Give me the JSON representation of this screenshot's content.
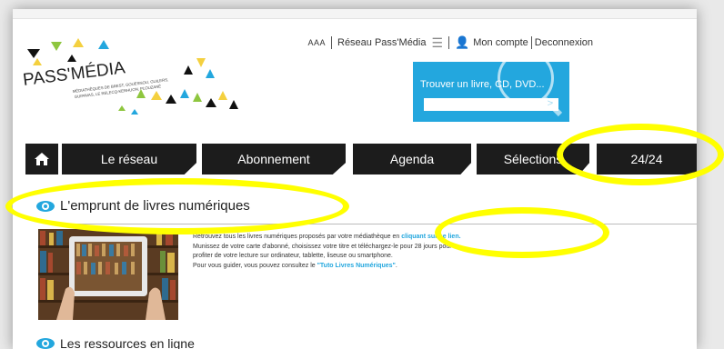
{
  "utility": {
    "font_size": "AAA",
    "network_link": "Réseau Pass'Média",
    "menu_icon": "hamburger-icon",
    "account": "Mon compte",
    "logout": "Deconnexion"
  },
  "logo": {
    "title": "PASS'MÉDIA",
    "subtitle_line1": "MÉDIATHÈQUES DE BREST, GOUESNOU, GUILERS,",
    "subtitle_line2": "GUIPAVAS, LE RELECQ-KERHUON, PLOUZANÉ"
  },
  "search": {
    "label": "Trouver un livre, CD, DVD...",
    "placeholder": "",
    "submit": ">"
  },
  "nav": {
    "home_icon": "home-icon",
    "items": [
      "Le réseau",
      "Abonnement",
      "Agenda",
      "Sélections",
      "24/24"
    ]
  },
  "section1": {
    "title": "L'emprunt de livres numériques",
    "lines": [
      "Retrouvez tous les livres numériques proposés par votre médiathèque en",
      "Munissez de votre carte d'abonné, choisissez votre titre et téléchargez-le pour 28 jours pour",
      "profiter de votre lecture sur ordinateur, tablette, liseuse ou smartphone.",
      "Pour vous guider, vous pouvez consultez le"
    ],
    "link_text": "cliquant sur ce lien.",
    "guide_link": "\"Tuto Livres Numériques\"",
    "guide_suffix": "."
  },
  "section2": {
    "title": "Les ressources en ligne"
  },
  "colors": {
    "accent": "#23a7de",
    "nav": "#1c1c1c",
    "highlight": "#ffff00"
  }
}
